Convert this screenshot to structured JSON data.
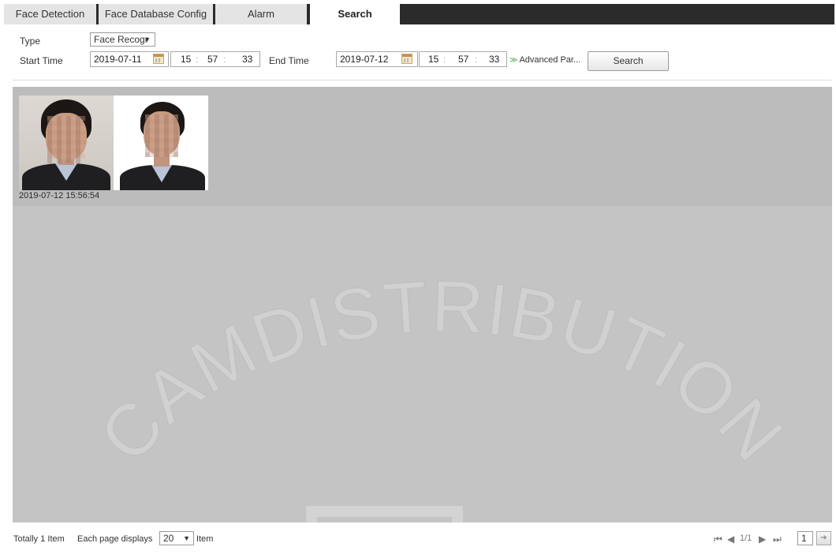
{
  "tabs": [
    {
      "label": "Face Detection"
    },
    {
      "label": "Face Database Config"
    },
    {
      "label": "Alarm"
    },
    {
      "label": "Search"
    }
  ],
  "filter": {
    "type_label": "Type",
    "type_value": "Face Recogr",
    "start_label": "Start Time",
    "start_date": "2019-07-11",
    "start_hh": "15",
    "start_mm": "57",
    "start_ss": "33",
    "end_label": "End Time",
    "end_date": "2019-07-12",
    "end_hh": "15",
    "end_mm": "57",
    "end_ss": "33",
    "advanced_label": "Advanced Par...",
    "search_button": "Search"
  },
  "results": [
    {
      "time": "2019-07-12 15:56:54"
    }
  ],
  "footer": {
    "total_text": "Totally 1 Item",
    "each_page_label": "Each page displays",
    "page_size": "20",
    "item_label": "Item",
    "page_indicator": "1/1",
    "page_input": "1"
  },
  "watermark": "CAMDISTRIBUTION"
}
